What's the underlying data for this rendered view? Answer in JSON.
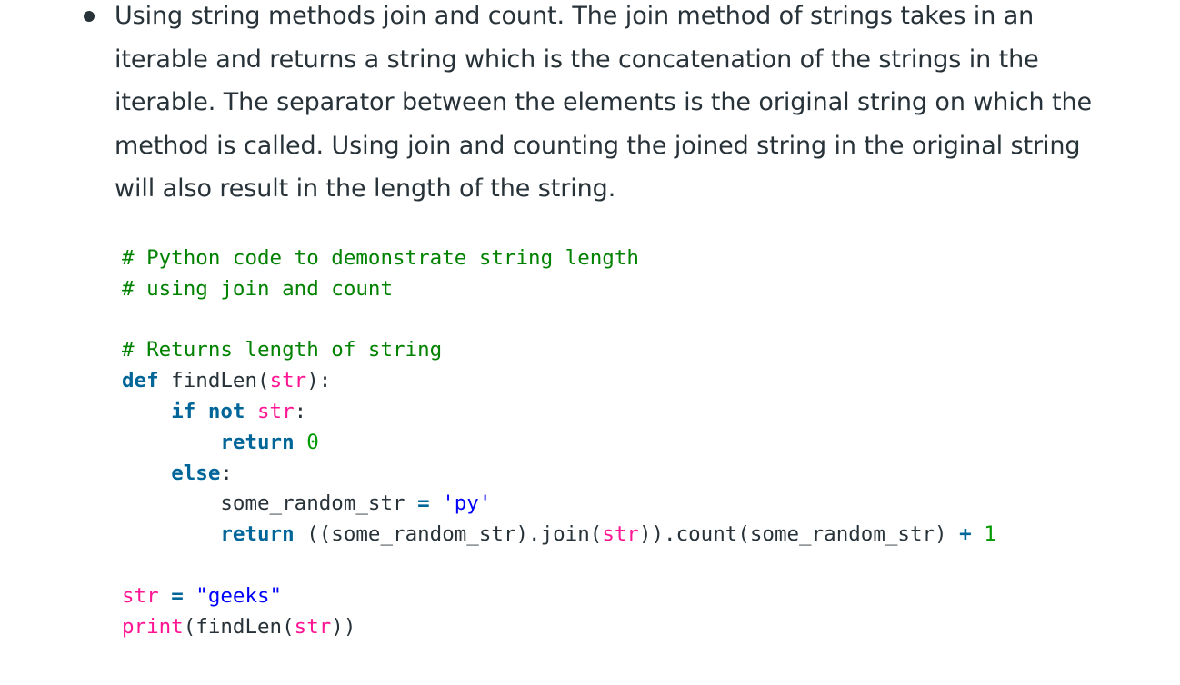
{
  "bullet": {
    "text": "Using string methods join and count. The join method of strings takes in an iterable and returns a string which is the concatenation of the strings in the iterable. The separator between the elements is the original string on which the method is called. Using join and counting the joined string in the original string will also result in the length of the string."
  },
  "code": {
    "language": "python",
    "lines": [
      [
        {
          "t": "comment",
          "v": "# Python code to demonstrate string length"
        }
      ],
      [
        {
          "t": "comment",
          "v": "# using join and count"
        }
      ],
      [],
      [
        {
          "t": "comment",
          "v": "# Returns length of string"
        }
      ],
      [
        {
          "t": "keyword",
          "v": "def"
        },
        {
          "t": "plain",
          "v": " findLen("
        },
        {
          "t": "builtin",
          "v": "str"
        },
        {
          "t": "plain",
          "v": "):"
        }
      ],
      [
        {
          "t": "plain",
          "v": "    "
        },
        {
          "t": "keyword",
          "v": "if"
        },
        {
          "t": "plain",
          "v": " "
        },
        {
          "t": "keyword",
          "v": "not"
        },
        {
          "t": "plain",
          "v": " "
        },
        {
          "t": "builtin",
          "v": "str"
        },
        {
          "t": "plain",
          "v": ":"
        }
      ],
      [
        {
          "t": "plain",
          "v": "        "
        },
        {
          "t": "keyword",
          "v": "return"
        },
        {
          "t": "plain",
          "v": " "
        },
        {
          "t": "number",
          "v": "0"
        }
      ],
      [
        {
          "t": "plain",
          "v": "    "
        },
        {
          "t": "keyword",
          "v": "else"
        },
        {
          "t": "plain",
          "v": ":"
        }
      ],
      [
        {
          "t": "plain",
          "v": "        some_random_str "
        },
        {
          "t": "op",
          "v": "="
        },
        {
          "t": "plain",
          "v": " "
        },
        {
          "t": "string",
          "v": "'py'"
        }
      ],
      [
        {
          "t": "plain",
          "v": "        "
        },
        {
          "t": "keyword",
          "v": "return"
        },
        {
          "t": "plain",
          "v": " ((some_random_str).join("
        },
        {
          "t": "builtin",
          "v": "str"
        },
        {
          "t": "plain",
          "v": ")).count(some_random_str) "
        },
        {
          "t": "op",
          "v": "+"
        },
        {
          "t": "plain",
          "v": " "
        },
        {
          "t": "number",
          "v": "1"
        }
      ],
      [],
      [
        {
          "t": "builtin",
          "v": "str"
        },
        {
          "t": "plain",
          "v": " "
        },
        {
          "t": "op",
          "v": "="
        },
        {
          "t": "plain",
          "v": " "
        },
        {
          "t": "string",
          "v": "\"geeks\""
        }
      ],
      [
        {
          "t": "builtin",
          "v": "print"
        },
        {
          "t": "plain",
          "v": "(findLen("
        },
        {
          "t": "builtin",
          "v": "str"
        },
        {
          "t": "plain",
          "v": "))"
        }
      ]
    ]
  },
  "colors": {
    "text": "#273239",
    "comment": "#008200",
    "keyword": "#006699",
    "builtin": "#ff1493",
    "string": "#0000ff",
    "number": "#009900"
  }
}
